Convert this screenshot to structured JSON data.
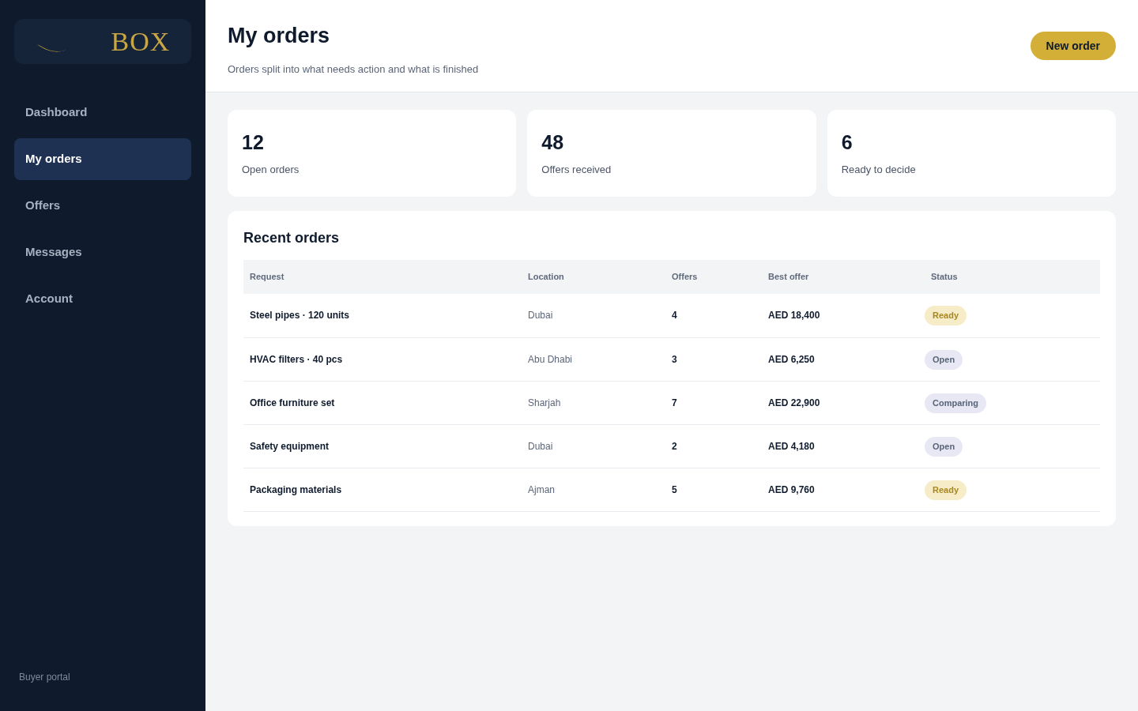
{
  "sidebar": {
    "logo": {
      "text": "BOX"
    },
    "items": [
      {
        "label": "Dashboard",
        "selected": false
      },
      {
        "label": "My orders",
        "selected": true
      },
      {
        "label": "Offers",
        "selected": false
      },
      {
        "label": "Messages",
        "selected": false
      },
      {
        "label": "Account",
        "selected": false
      }
    ],
    "footer": "Buyer portal"
  },
  "header": {
    "title": "My orders",
    "subtitle": "Orders split into what needs action and what is finished",
    "button": "New order"
  },
  "stats": [
    {
      "value": "12",
      "label": "Open orders"
    },
    {
      "value": "48",
      "label": "Offers received"
    },
    {
      "value": "6",
      "label": "Ready to decide"
    }
  ],
  "recent_orders": {
    "title": "Recent orders",
    "columns": [
      "Request",
      "Location",
      "Offers",
      "Best offer",
      "Status"
    ],
    "rows": [
      {
        "request": "Steel pipes · 120 units",
        "location": "Dubai",
        "offers": "4",
        "best_offer": "AED 18,400",
        "status": {
          "label": "Ready",
          "kind": "accent"
        }
      },
      {
        "request": "HVAC filters · 40 pcs",
        "location": "Abu Dhabi",
        "offers": "3",
        "best_offer": "AED 6,250",
        "status": {
          "label": "Open",
          "kind": "muted"
        }
      },
      {
        "request": "Office furniture set",
        "location": "Sharjah",
        "offers": "7",
        "best_offer": "AED 22,900",
        "status": {
          "label": "Comparing",
          "kind": "muted"
        }
      },
      {
        "request": "Safety equipment",
        "location": "Dubai",
        "offers": "2",
        "best_offer": "AED 4,180",
        "status": {
          "label": "Open",
          "kind": "muted"
        }
      },
      {
        "request": "Packaging materials",
        "location": "Ajman",
        "offers": "5",
        "best_offer": "AED 9,760",
        "status": {
          "label": "Ready",
          "kind": "accent"
        }
      }
    ]
  }
}
